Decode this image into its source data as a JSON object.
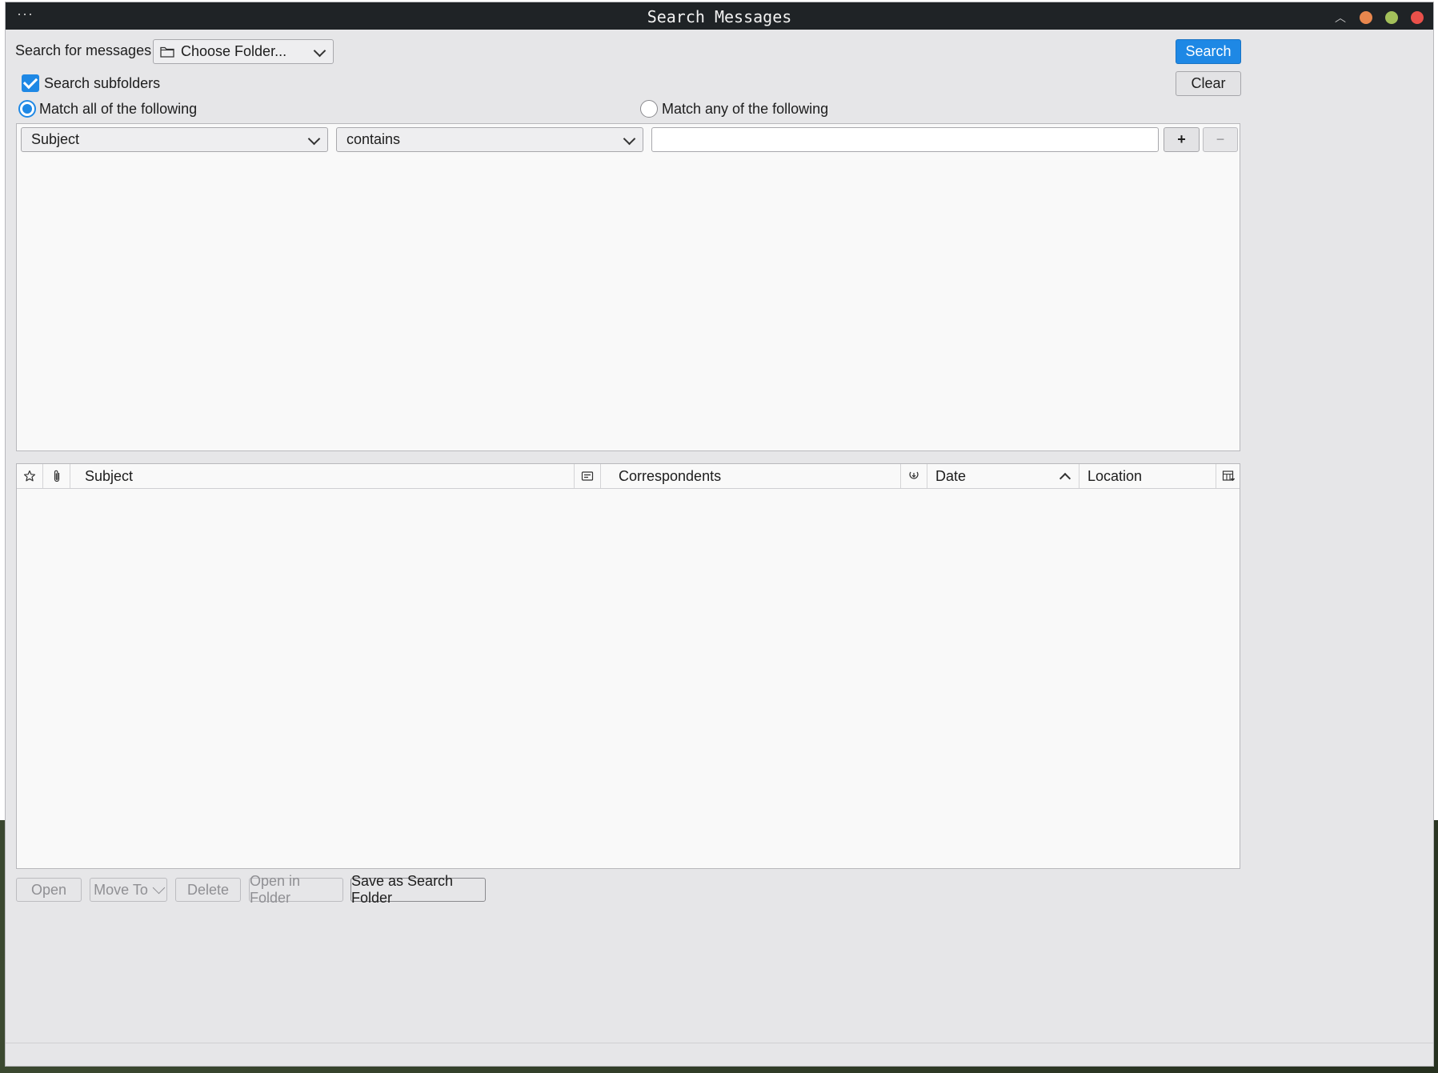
{
  "window": {
    "title": "Search Messages",
    "menu_glyph": "···",
    "colors": {
      "minimize": "#e8874e",
      "maximize": "#a3c05a",
      "close": "#e9504a",
      "accent": "#1e88e5"
    }
  },
  "search_in": {
    "label": "Search for messages in:",
    "folder_value": "Choose Folder...",
    "folder_icon": "folder-icon"
  },
  "buttons": {
    "search": "Search",
    "clear": "Clear",
    "add": "+",
    "remove": "−"
  },
  "options": {
    "search_subfolders": "Search subfolders",
    "search_subfolders_checked": true,
    "match_all": "Match all of the following",
    "match_any": "Match any of the following",
    "selected_match": "all"
  },
  "term": {
    "field": "Subject",
    "operator": "contains",
    "value": ""
  },
  "results": {
    "columns": [
      {
        "type": "icon",
        "icon": "star-icon"
      },
      {
        "type": "icon",
        "icon": "paperclip-icon"
      },
      {
        "type": "text",
        "label": "Subject"
      },
      {
        "type": "icon",
        "icon": "thread-icon"
      },
      {
        "type": "text",
        "label": "Correspondents"
      },
      {
        "type": "icon",
        "icon": "junk-status-icon"
      },
      {
        "type": "text",
        "label": "Date",
        "sorted": "ascending"
      },
      {
        "type": "text",
        "label": "Location"
      },
      {
        "type": "icon",
        "icon": "column-picker-icon"
      }
    ],
    "rows": []
  },
  "actions": {
    "open": "Open",
    "move_to": "Move To",
    "delete": "Delete",
    "open_in_folder": "Open in Folder",
    "save_as_search_folder": "Save as Search Folder"
  }
}
